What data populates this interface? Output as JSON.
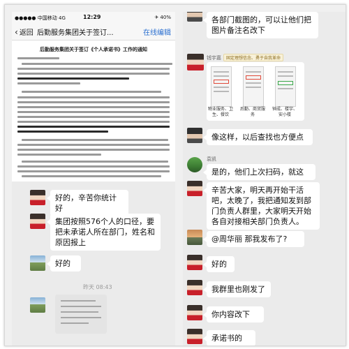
{
  "phone": {
    "carrier": "●●●●● 中国移动 4G",
    "time": "12:29",
    "battery": "✈ 40%"
  },
  "nav": {
    "back_label": "返回",
    "title": "后勤服务集团关于签订...",
    "edit_label": "在线编辑"
  },
  "document": {
    "title": "后勤服务集团关于签订《个人承诺书》工作的通知"
  },
  "left_chat": {
    "messages": [
      {
        "text": "好的，辛苦你统计好"
      },
      {
        "text": "集团按照576个人的口径，要把未承诺人所在部门，姓名和原因报上"
      },
      {
        "text": "好的"
      }
    ],
    "timestamp": "昨天 08:43"
  },
  "right_chat": {
    "top_message": "各部门截图的，可以让他们把图片备注名改下",
    "sender_name": "钱宇嘉",
    "sender_tag": "固定理想信念、勇于自我革命",
    "screenshot_captions": [
      "物业服务、卫生、餐饮",
      "后勤、商贸服务",
      "钟成、楼宇、安小楼"
    ],
    "messages": [
      {
        "text": "像这样，以后查找也方便点"
      },
      {
        "sender": "袁凯",
        "text": "是的，他们上次扫码，就这"
      },
      {
        "text": "辛苦大家，明天再开始干活吧，太晚了，我把通知发到部门负责人群里，大家明天开始各自对接相关部门负责人。"
      },
      {
        "text": "@周华丽 那我发布了?"
      },
      {
        "text": "好的"
      },
      {
        "text": "我群里也刚发了"
      },
      {
        "text": "你内容改下"
      },
      {
        "text": "承诺书的"
      }
    ]
  }
}
